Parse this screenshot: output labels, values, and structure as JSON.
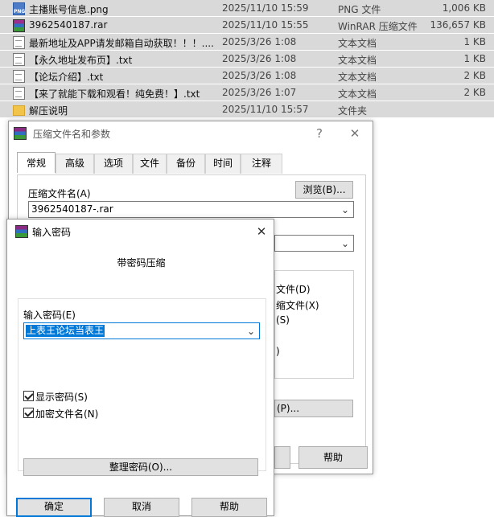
{
  "files": [
    {
      "icon": "png-file-icon",
      "name": "主播账号信息.png",
      "date": "2025/11/10 15:59",
      "type": "PNG 文件",
      "size": "1,006 KB"
    },
    {
      "icon": "rar-file-icon",
      "name": "3962540187.rar",
      "date": "2025/11/10 15:55",
      "type": "WinRAR 压缩文件",
      "size": "136,657 KB"
    },
    {
      "icon": "text-file-icon",
      "name": "最新地址及APP请发邮箱自动获取！！！....",
      "date": "2025/3/26 1:08",
      "type": "文本文档",
      "size": "1 KB"
    },
    {
      "icon": "text-file-icon",
      "name": "【永久地址发布页】.txt",
      "date": "2025/3/26 1:08",
      "type": "文本文档",
      "size": "1 KB"
    },
    {
      "icon": "text-file-icon",
      "name": "【论坛介绍】.txt",
      "date": "2025/3/26 1:08",
      "type": "文本文档",
      "size": "2 KB"
    },
    {
      "icon": "text-file-icon",
      "name": "【来了就能下载和观看！纯免费！】.txt",
      "date": "2025/3/26 1:07",
      "type": "文本文档",
      "size": "2 KB"
    },
    {
      "icon": "folder-icon",
      "name": "解压说明",
      "date": "2025/11/10 15:57",
      "type": "文件夹",
      "size": ""
    }
  ],
  "archive_dialog": {
    "title": "压缩文件名和参数",
    "help_symbol": "?",
    "close_symbol": "✕",
    "tabs": [
      "常规",
      "高级",
      "选项",
      "文件",
      "备份",
      "时间",
      "注释"
    ],
    "archive_name_label": "压缩文件名(A)",
    "browse_button": "浏览(B)...",
    "archive_name_value": "3962540187-.rar",
    "partial_options": [
      "文件(D)",
      "缩文件(X)",
      "(S)",
      ")"
    ],
    "partial_button": "(P)...",
    "help_button": "帮助"
  },
  "password_dialog": {
    "title": "输入密码",
    "close_symbol": "✕",
    "heading": "带密码压缩",
    "password_label": "输入密码(E)",
    "password_value": "上表王论坛当表王",
    "show_password_label": "显示密码(S)",
    "show_password_checked": true,
    "encrypt_names_label": "加密文件名(N)",
    "encrypt_names_checked": true,
    "organize_button": "整理密码(O)...",
    "ok_button": "确定",
    "cancel_button": "取消",
    "help_button": "帮助"
  },
  "colors": {
    "selection": "#0078d7",
    "row": "#d9d9d9"
  }
}
